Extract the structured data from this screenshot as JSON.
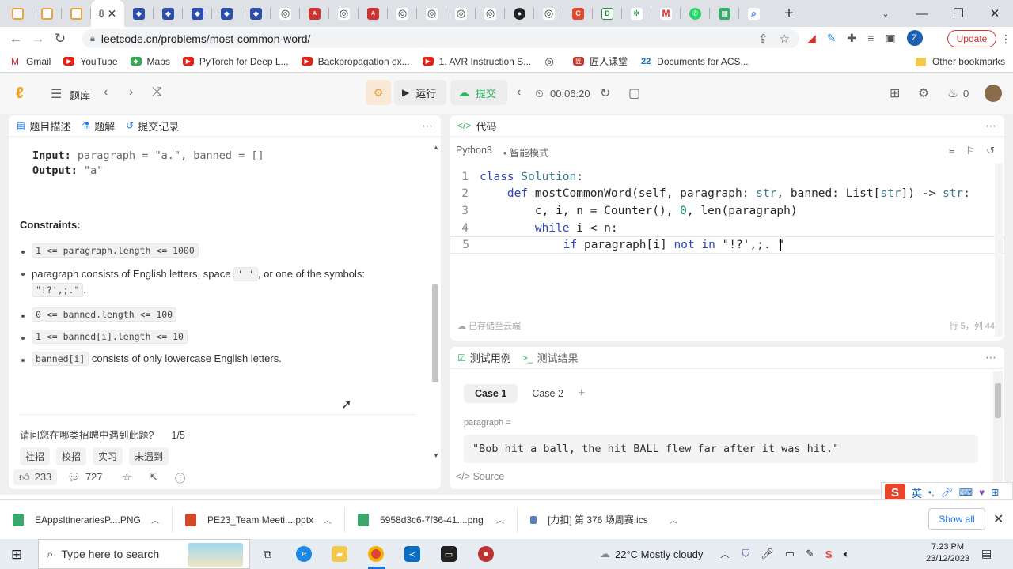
{
  "browser": {
    "active_tab_title": "8",
    "tab_count_shown": 28,
    "url": "leetcode.cn/problems/most-common-word/",
    "update_label": "Update",
    "profile_initial": "Z",
    "accent": "#1a73e8"
  },
  "bookmarks": {
    "items": [
      "Gmail",
      "YouTube",
      "Maps",
      "PyTorch for Deep L...",
      "Backpropagation ex...",
      "1. AVR Instruction S...",
      "",
      "匠人课堂",
      "Documents for ACS..."
    ],
    "other": "Other bookmarks"
  },
  "lc_header": {
    "problem_list": "题库",
    "run": "运行",
    "submit": "提交",
    "timer": "00:06:20",
    "points": "0"
  },
  "left_panel": {
    "tabs": [
      "题目描述",
      "题解",
      "提交记录"
    ],
    "example": {
      "input_label": "Input:",
      "input_value": "paragraph = \"a.\", banned = []",
      "output_label": "Output:",
      "output_value": "\"a\""
    },
    "constraints_title": "Constraints:",
    "constraints": {
      "c1_code": "1 <= paragraph.length <= 1000",
      "c2_pre": "paragraph consists of English letters, space ",
      "c2_code1": "' '",
      "c2_mid": ", or one of the symbols:",
      "c2_code2": "\"!?',;.\"",
      "c2_post": ".",
      "c3_code": "0 <= banned.length <= 100",
      "c4_code": "1 <= banned[i].length <= 10",
      "c5_code": "banned[i]",
      "c5_post": " consists of only lowercase English letters."
    },
    "survey_question": "请问您在哪类招聘中遇到此题?",
    "survey_progress": "1/5",
    "survey_options": [
      "社招",
      "校招",
      "实习",
      "未遇到"
    ],
    "likes": "233",
    "comments": "727"
  },
  "editor": {
    "title": "代码",
    "language": "Python3",
    "mode": "智能模式",
    "saved": "已存储至云端",
    "cursor": "行 5，列 44",
    "lines": [
      {
        "n": "1",
        "text": "class Solution:"
      },
      {
        "n": "2",
        "text": "    def mostCommonWord(self, paragraph: str, banned: List[str]) -> str:"
      },
      {
        "n": "3",
        "text": "        c, i, n = Counter(), 0, len(paragraph)"
      },
      {
        "n": "4",
        "text": "        while i < n:"
      },
      {
        "n": "5",
        "text": "            if paragraph[i] not in \"!?',;. \""
      }
    ]
  },
  "test_panel": {
    "tab_cases": "测试用例",
    "tab_results": "测试结果",
    "cases": [
      "Case 1",
      "Case 2"
    ],
    "param_label": "paragraph =",
    "param_value": "\"Bob hit a ball, the hit BALL flew far after it was hit.\"",
    "source_label": "Source"
  },
  "downloads": {
    "items": [
      "EAppsItinerariesP....PNG",
      "PE23_Team Meeti....pptx",
      "5958d3c6-7f36-41....png",
      "[力扣] 第 376 场周赛.ics"
    ],
    "show_all": "Show all"
  },
  "taskbar": {
    "search_placeholder": "Type here to search",
    "weather": "22°C  Mostly cloudy",
    "time": "7:23 PM",
    "date": "23/12/2023"
  },
  "ime": {
    "lang": "英"
  }
}
